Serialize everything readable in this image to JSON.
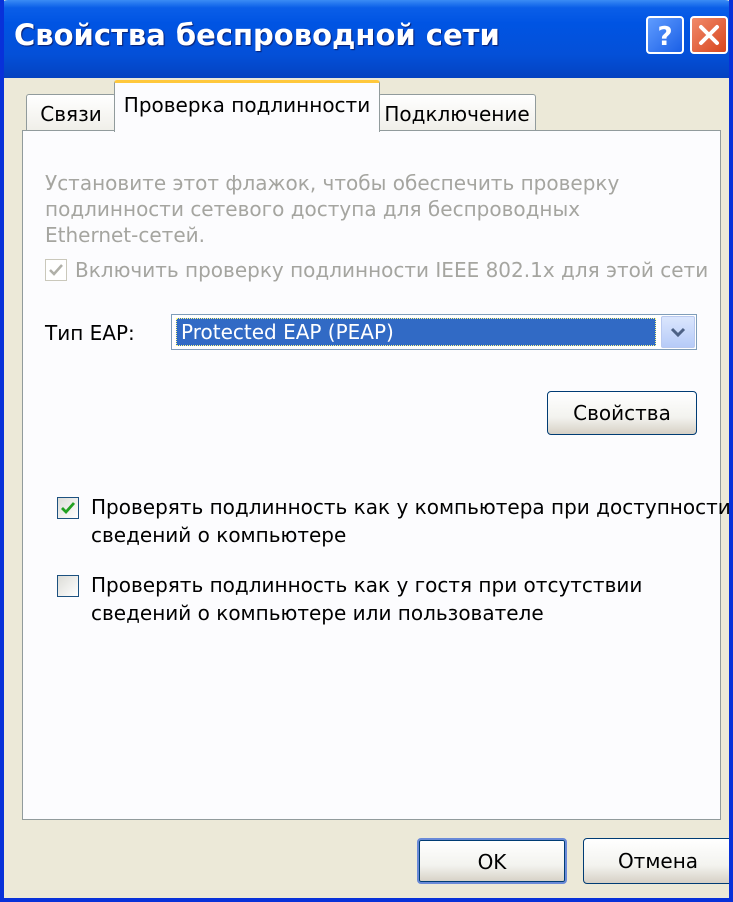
{
  "window": {
    "title": "Свойства беспроводной сети",
    "help_icon": "help-icon",
    "close_icon": "close-icon"
  },
  "tabs": [
    {
      "label": "Связи",
      "active": false
    },
    {
      "label": "Проверка подлинности",
      "active": true
    },
    {
      "label": "Подключение",
      "active": false
    }
  ],
  "panel": {
    "description_lines": [
      "Установите этот флажок, чтобы обеспечить проверку",
      "подлинности сетевого доступа для беспроводных",
      "Ethernet-сетей."
    ],
    "enable_8021x": {
      "label": "Включить проверку подлинности IEEE 802.1x для этой сети",
      "checked": true,
      "enabled": false
    },
    "eap_type": {
      "label": "Тип EAP:",
      "value": "Protected EAP (PEAP)"
    },
    "properties_button": "Свойства",
    "auth_as_computer": {
      "lines": [
        "Проверять подлинность как у компьютера при доступности",
        "сведений о компьютере"
      ],
      "checked": true
    },
    "auth_as_guest": {
      "lines": [
        "Проверять подлинность как у гостя при отсутствии",
        "сведений о компьютере или пользователе"
      ],
      "checked": false
    }
  },
  "footer": {
    "ok_label": "OK",
    "cancel_label": "Отмена"
  },
  "colors": {
    "titlebar": "#0054e3",
    "dialog_bg": "#ece9d8",
    "selection": "#316ac5",
    "disabled_text": "#a5a5a0"
  }
}
